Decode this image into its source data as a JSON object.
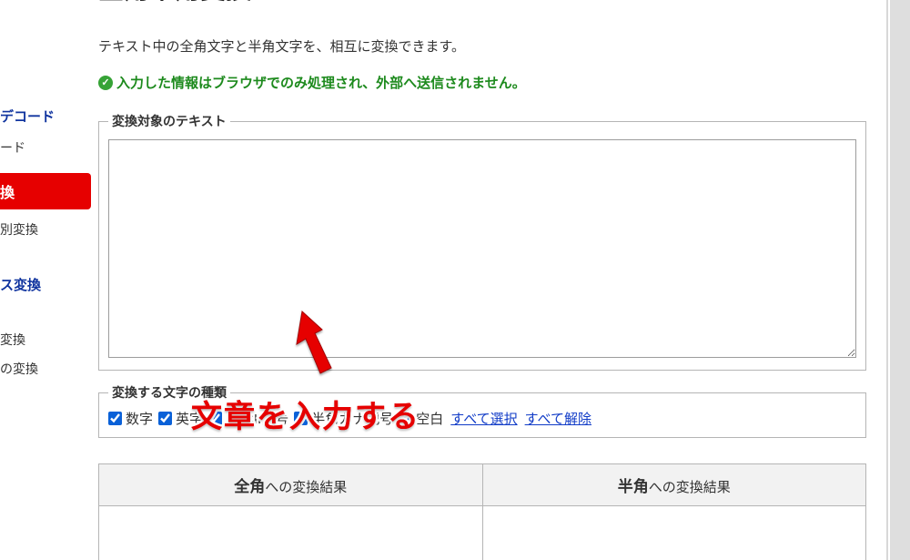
{
  "sidebar": {
    "items": [
      {
        "label": "デコード",
        "type": "head"
      },
      {
        "label": "ード",
        "type": "sub"
      },
      {
        "label": "換",
        "type": "active"
      },
      {
        "label": "別変換",
        "type": "sub"
      },
      {
        "label": "ス変換",
        "type": "head"
      },
      {
        "label": "変換",
        "type": "sub"
      },
      {
        "label": "の変換",
        "type": "sub"
      }
    ]
  },
  "page": {
    "title": "全角半角変換",
    "description": "テキスト中の全角文字と半角文字を、相互に変換できます。",
    "notice": "入力した情報はブラウザでのみ処理され、外部へ送信されません。"
  },
  "input_fieldset": {
    "legend": "変換対象のテキスト",
    "textarea_value": ""
  },
  "options_fieldset": {
    "legend": "変換する文字の種類",
    "checkboxes": [
      {
        "label": "数字",
        "checked": true
      },
      {
        "label": "英字",
        "checked": true
      },
      {
        "label": "ASCII記号",
        "checked": true
      },
      {
        "label": "半角カナ記号",
        "checked": true
      },
      {
        "label": "空白",
        "checked": true
      }
    ],
    "select_all": "すべて選択",
    "deselect_all": "すべて解除"
  },
  "results": {
    "col1_strong": "全角",
    "col1_rest": "への変換結果",
    "col2_strong": "半角",
    "col2_rest": "への変換結果"
  },
  "annotation": {
    "text": "文章を入力する"
  }
}
